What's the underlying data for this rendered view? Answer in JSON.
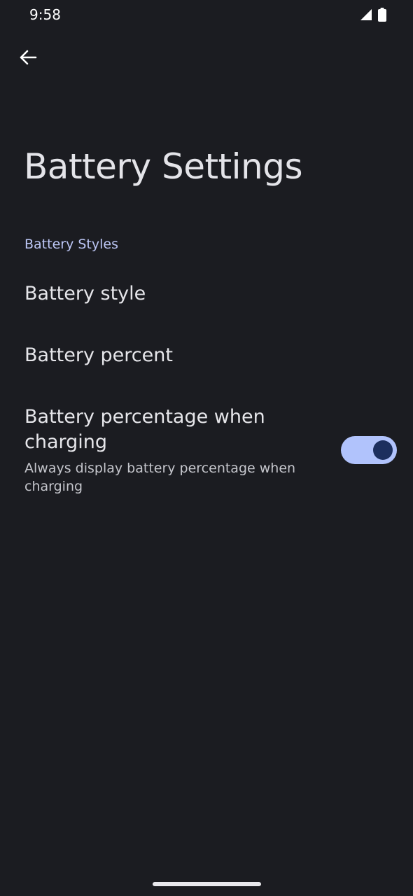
{
  "status_bar": {
    "time": "9:58",
    "icons": [
      "signal-icon",
      "battery-icon"
    ]
  },
  "toolbar": {
    "back_icon": "arrow-back-icon"
  },
  "page": {
    "title": "Battery Settings"
  },
  "category": {
    "title": "Battery Styles"
  },
  "preferences": [
    {
      "title": "Battery style"
    },
    {
      "title": "Battery percent"
    },
    {
      "title": "Battery percentage when charging",
      "summary": "Always display battery percentage when charging",
      "toggle_on": true
    }
  ],
  "colors": {
    "background": "#1b1c21",
    "accent": "#bcc6f5",
    "toggle_track_on": "#b1c3fc",
    "toggle_thumb_on": "#1c2f5e"
  }
}
